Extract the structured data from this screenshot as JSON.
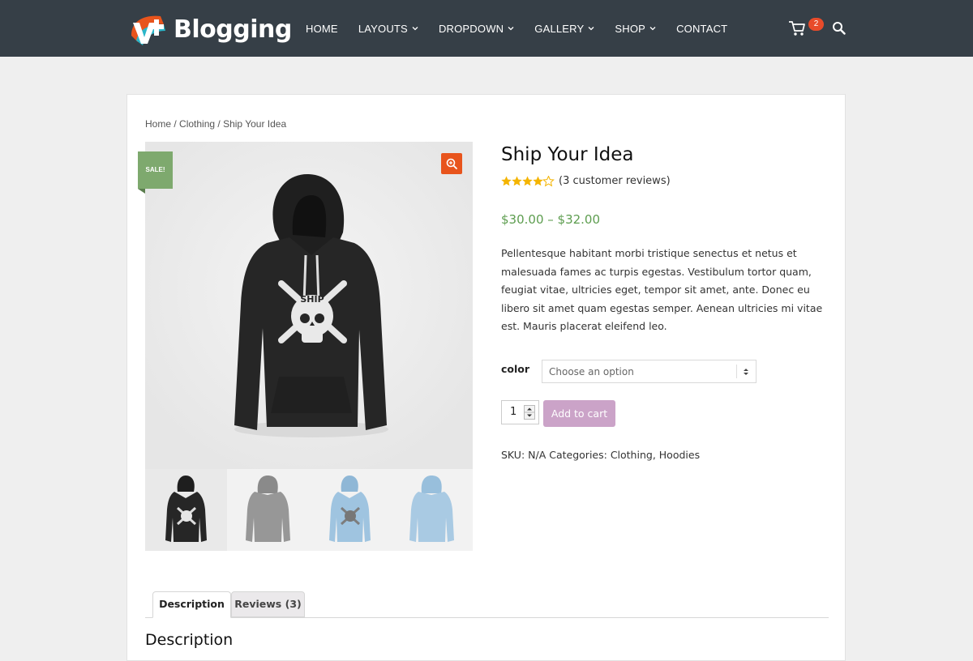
{
  "header": {
    "logo_text": "Blogging",
    "nav": [
      {
        "label": "HOME",
        "has_dropdown": false
      },
      {
        "label": "LAYOUTS",
        "has_dropdown": true
      },
      {
        "label": "DROPDOWN",
        "has_dropdown": true
      },
      {
        "label": "GALLERY",
        "has_dropdown": true
      },
      {
        "label": "SHOP",
        "has_dropdown": true
      },
      {
        "label": "CONTACT",
        "has_dropdown": false
      }
    ],
    "cart_count": "2"
  },
  "breadcrumb": {
    "home": "Home",
    "sep1": " / ",
    "category": "Clothing",
    "sep2": " / ",
    "current": "Ship Your Idea"
  },
  "product": {
    "sale_badge": "SALE!",
    "title": "Ship Your Idea",
    "rating": 4,
    "rating_max": 5,
    "reviews_link": "(3 customer reviews)",
    "price": "$30.00 – $32.00",
    "description": "Pellentesque habitant morbi tristique senectus et netus et malesuada fames ac turpis egestas. Vestibulum tortor quam, feugiat vitae, ultricies eget, tempor sit amet, ante. Donec eu libero sit amet quam egestas semper. Aenean ultricies mi vitae est. Mauris placerat eleifend leo.",
    "color_label": "color",
    "color_placeholder": "Choose an option",
    "quantity": "1",
    "add_to_cart": "Add to cart",
    "meta": {
      "sku_label": "SKU: ",
      "sku_value": "N/A",
      "categories_label": " Categories: ",
      "cat1": "Clothing",
      "cat_sep": ", ",
      "cat2": "Hoodies"
    },
    "thumbnails": [
      {
        "name": "black-hoodie-front",
        "color": "#2a2a2a"
      },
      {
        "name": "grey-hoodie-back",
        "color": "#8e8e8e"
      },
      {
        "name": "blue-hoodie-front",
        "color": "#9ec3df"
      },
      {
        "name": "blue-hoodie-back",
        "color": "#a7c8e2"
      }
    ]
  },
  "tabs": [
    {
      "label": "Description",
      "active": true
    },
    {
      "label": "Reviews (3)",
      "active": false
    }
  ],
  "description_heading": "Description",
  "colors": {
    "header_bg": "#363f47",
    "price": "#5d9d4f",
    "sale": "#7ea96e",
    "zoom": "#e8541c",
    "add_to_cart": "#cba3c8",
    "badge": "#e84b2a"
  }
}
